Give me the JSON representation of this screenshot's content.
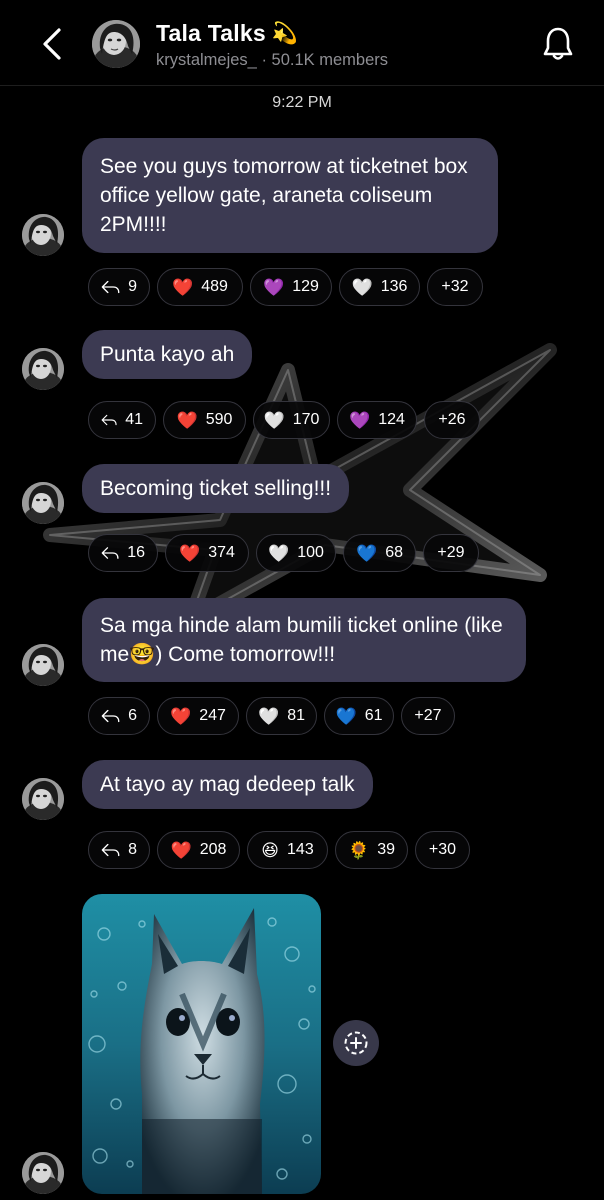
{
  "header": {
    "title": "Tala Talks",
    "title_emoji": "💫",
    "username": "krystalmejes_",
    "separator": " · ",
    "members": "50.1K members"
  },
  "timestamp": "9:22 PM",
  "messages": [
    {
      "text": "See you guys tomorrow at ticketnet box office yellow gate, araneta coliseum 2PM!!!!",
      "replies": "9",
      "reactions": [
        {
          "emoji": "❤️",
          "count": "489"
        },
        {
          "emoji": "💜",
          "count": "129"
        },
        {
          "emoji": "🤍",
          "count": "136"
        }
      ],
      "more": "+32"
    },
    {
      "text": "Punta kayo ah",
      "replies": "41",
      "reactions": [
        {
          "emoji": "❤️",
          "count": "590"
        },
        {
          "emoji": "🤍",
          "count": "170"
        },
        {
          "emoji": "💜",
          "count": "124"
        }
      ],
      "more": "+26"
    },
    {
      "text": "Becoming ticket selling!!!",
      "replies": "16",
      "reactions": [
        {
          "emoji": "❤️",
          "count": "374"
        },
        {
          "emoji": "🤍",
          "count": "100"
        },
        {
          "emoji": "💙",
          "count": "68"
        }
      ],
      "more": "+29"
    },
    {
      "text_before": "Sa mga hinde alam bumili ticket online (like me",
      "text_emoji": "🤓",
      "text_after": ") Come tomorrow!!!",
      "replies": "6",
      "reactions": [
        {
          "emoji": "❤️",
          "count": "247"
        },
        {
          "emoji": "🤍",
          "count": "81"
        },
        {
          "emoji": "💙",
          "count": "61"
        }
      ],
      "more": "+27"
    },
    {
      "text": "At tayo ay mag dedeep talk",
      "replies": "8",
      "reactions": [
        {
          "emoji": "❤️",
          "count": "208"
        },
        {
          "emoji": "😆",
          "count": "143"
        },
        {
          "emoji": "🌻",
          "count": "39"
        }
      ],
      "more": "+30"
    }
  ],
  "colors": {
    "background": "#000000",
    "bubble": "#3c3a52",
    "pill_border": "#34343c",
    "subtitle": "#8e8e93"
  }
}
